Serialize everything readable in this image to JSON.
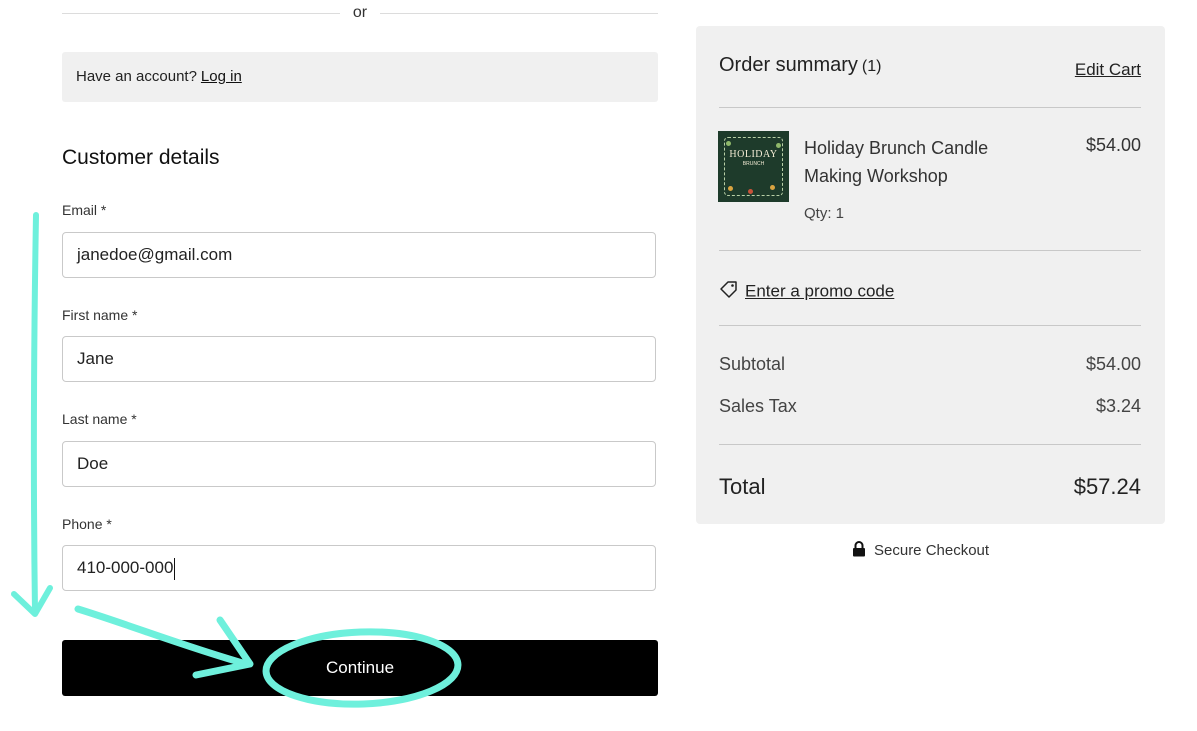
{
  "divider": {
    "text": "or"
  },
  "account": {
    "prompt": "Have an account?",
    "login_link": "Log in"
  },
  "customer": {
    "title": "Customer details",
    "fields": [
      {
        "label": "Email *",
        "value": "janedoe@gmail.com"
      },
      {
        "label": "First name *",
        "value": "Jane"
      },
      {
        "label": "Last name *",
        "value": "Doe"
      },
      {
        "label": "Phone *",
        "value": "410-000-000"
      }
    ],
    "continue_label": "Continue"
  },
  "summary": {
    "title": "Order summary",
    "count": "(1)",
    "edit_cart": "Edit Cart",
    "item": {
      "name": "Holiday Brunch Candle Making Workshop",
      "price": "$54.00",
      "qty": "Qty: 1",
      "thumb_title": "HOLIDAY",
      "thumb_subtitle": "BRUNCH"
    },
    "promo": "Enter a promo code",
    "subtotal_label": "Subtotal",
    "subtotal_value": "$54.00",
    "tax_label": "Sales Tax",
    "tax_value": "$3.24",
    "total_label": "Total",
    "total_value": "$57.24"
  },
  "secure": {
    "text": "Secure Checkout",
    "icon": "lock-icon"
  },
  "annotation": {
    "color": "#6ef0dc",
    "shapes": [
      "down-arrow",
      "right-arrow",
      "circle-around-continue"
    ]
  },
  "colors": {
    "button": "#000000",
    "panel": "#f0f0f0",
    "annotation": "#6ef0dc"
  }
}
